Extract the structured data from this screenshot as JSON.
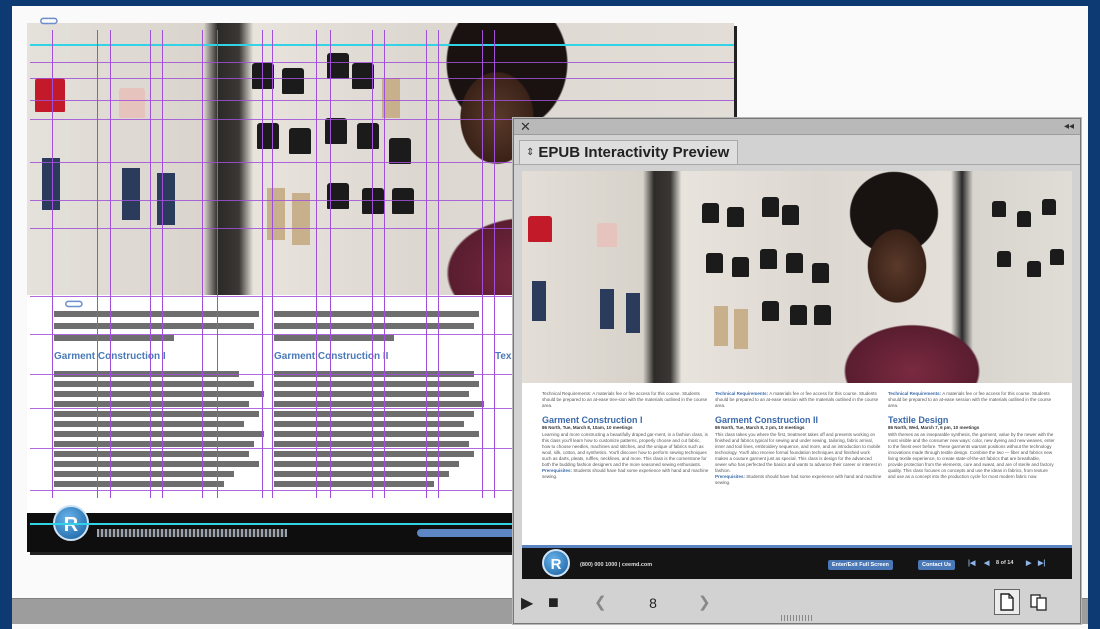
{
  "panel": {
    "title": "EPUB Interactivity Preview",
    "close_glyph": "✕",
    "collapse_glyph": "◂◂",
    "sort_glyph": "⇕",
    "current_page": "8",
    "play_glyph": "▶",
    "stop_glyph": "■",
    "prev_glyph": "❮",
    "next_glyph": "❯"
  },
  "document": {
    "headings": [
      "Garment Construction I",
      "Garment Construction II",
      "Tex"
    ]
  },
  "preview": {
    "columns": [
      {
        "req": "Technical Requirements: A materials fee or fee access for this course. Students should be prepared to an at-ease trev-sion with the materials outlined in the course area.",
        "req_bold": "",
        "title": "Garment Construction I",
        "schedule": "86 North, Tue, March 8, 10am, 10 meetings",
        "body": "Learning and more constructing a beautifully draped gar-ment, in a fashion class, is this class you'll learn how to customize patterns, properly choose and cut fabric, how to choose needles, machines and stitches, and the unique of fabrics such as wool, silk, cotton, and synthetics. You'll discover how to perform sewing techniques such as darts, pleats, ruffles, necklines, and more. This class is the cornerstone for both the budding fashion designers and the more seasoned sewing enthusiasts.",
        "prereq_label": "Prerequisites:",
        "prereq": "Students should have had some experience with hand and machine sewing."
      },
      {
        "req": "A materials fee or fee access for this course. Students should be prepared to an at-ease session with the materials outlined in the course area.",
        "req_bold": "Technical Requirements:",
        "title": "Garment Construction II",
        "schedule": "86 North, Tue, March 8, 2 pm, 10 meetings",
        "body": "This class takes you where the first, treatment takes off and presents working on finished and fabrics typical for sewing and under sewing, tailoring, fabric arrival, inner and tool lines, embroidery sequence, and more, and an introduction to mobile technology. You'll also receive formal foundation techniques and finished work makes a couture garment just as special. This class is design for the advanced sewer who has perfected the basics and wants to advance their career or interest in fashion.",
        "prereq_label": "Prerequisites:",
        "prereq": "Students should have had some experience with hand and machine sewing."
      },
      {
        "req": "A materials fee or fee access for this course. Students should be prepared to an at-ease session with the materials outlined in the course area.",
        "req_bold": "Technical Requirements:",
        "title": "Textile Design",
        "schedule": "86 North, Wed, March 7, 6 pm, 10 meetings",
        "body": "With themes as an inseparable synthesis, the garment, value by the newer with the most visible and the consumer new ways: color, new dyeing and new weaves, enter to the finest ever before. These garments warrant positions without the technology innovations made through textile design. Combine the two — fiber and fabrics new living textile experience, to create state-of-the-art fabrics that are breathable, provide protection from the elements, cure and sweat, and are of sterile and factory quality. This class focuses on concepts and use the ideas in fabrics, from texture and use as a concept into the production cycle for most modern fabric now."
      }
    ],
    "phone": "(800) 000 1000  |  ceemd.com",
    "btn_fullscreen": "Enter/Exit Full Screen",
    "btn_contact": "Contact Us",
    "page_indicator": "8 of 14"
  },
  "colors": {
    "accent_blue": "#3d6aa9",
    "guide_purple": "#a050d8",
    "guide_cyan": "#32d3e6",
    "desktop_blue": "#0d3a73"
  }
}
